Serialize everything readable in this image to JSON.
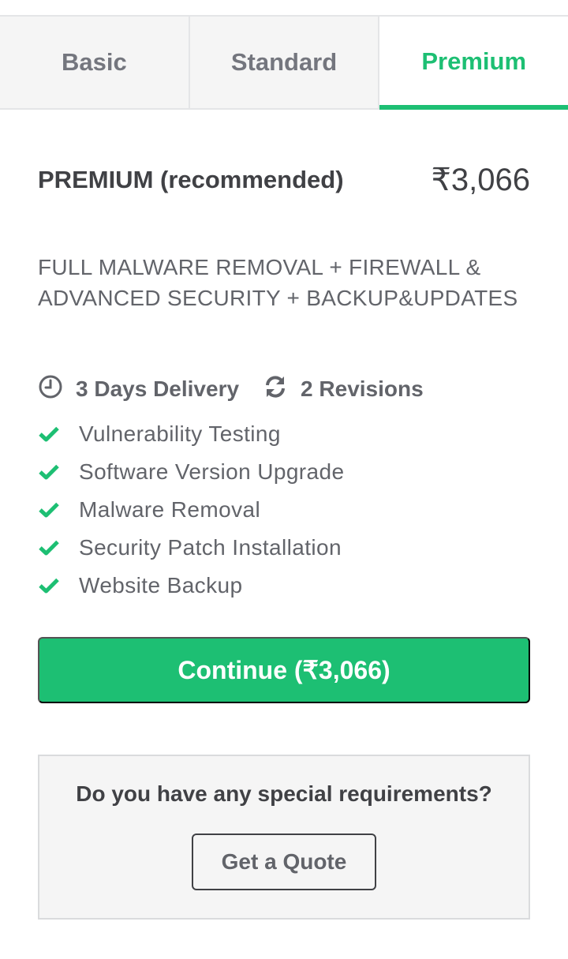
{
  "tabs": [
    {
      "label": "Basic",
      "active": false
    },
    {
      "label": "Standard",
      "active": false
    },
    {
      "label": "Premium",
      "active": true
    }
  ],
  "package": {
    "title": "PREMIUM (recommended)",
    "price": "₹3,066",
    "description": "FULL MALWARE REMOVAL + FIREWALL & ADVANCED SECURITY + BACKUP&UPDATES",
    "delivery": "3 Days Delivery",
    "revisions": "2 Revisions",
    "features": [
      "Vulnerability Testing",
      "Software Version Upgrade",
      "Malware Removal",
      "Security Patch Installation",
      "Website Backup"
    ],
    "continue_label": "Continue (₹3,066)"
  },
  "quote": {
    "question": "Do you have any special requirements?",
    "button_label": "Get a Quote"
  },
  "icons": {
    "delivery": "clock-icon",
    "revisions": "refresh-icon",
    "feature": "check-icon"
  },
  "colors": {
    "accent": "#1dbf73",
    "text_dark": "#404145",
    "text_muted": "#62646a",
    "tab_inactive": "#74767e",
    "panel_bg": "#f5f5f5"
  }
}
